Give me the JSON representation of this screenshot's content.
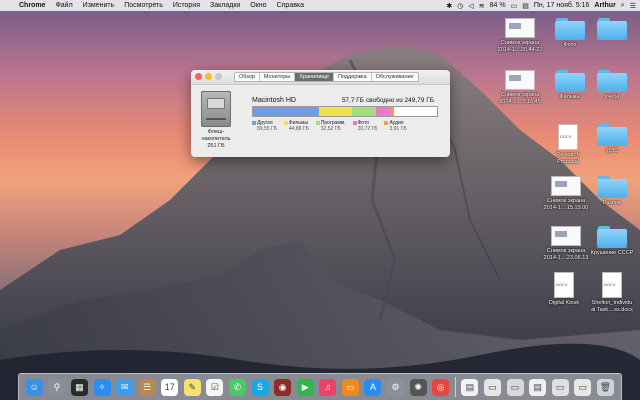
{
  "menubar": {
    "app": "Chrome",
    "items": [
      "Файл",
      "Изменить",
      "Посмотреть",
      "История",
      "Закладки",
      "Окно",
      "Справка"
    ],
    "battery": "84 %",
    "datetime": "Пн, 17 нояб.  5:16",
    "user": "Arthur"
  },
  "window": {
    "tabs": [
      "Обзор",
      "Мониторы",
      "Хранилище",
      "Поддержка",
      "Обслуживание"
    ],
    "active_tab": "Хранилище",
    "disk_label_lines": [
      "Флеш-",
      "накопитель",
      "251 ГБ"
    ],
    "disk_name": "Macintosh HD",
    "disk_free": "57,7 ГБ свободно из 249,79 ГБ",
    "storage": [
      {
        "label": "Другое",
        "size": "89,55 ГБ",
        "color": "#6f9fe0",
        "fraction": 0.358
      },
      {
        "label": "Фильмы",
        "size": "44,88 ГБ",
        "color": "#f5e04a",
        "fraction": 0.18
      },
      {
        "label": "Программ.",
        "size": "32,52 ГБ",
        "color": "#9ee07a",
        "fraction": 0.13
      },
      {
        "label": "Фото",
        "size": "20,72 ГБ",
        "color": "#f078c8",
        "fraction": 0.083
      },
      {
        "label": "Аудио",
        "size": "3,91 ГБ",
        "color": "#f5a03a",
        "fraction": 0.016
      }
    ]
  },
  "desktop_icons": [
    {
      "kind": "shot",
      "label": [
        "Снимок экрана",
        "2014-1....20.44.22"
      ]
    },
    {
      "kind": "folder",
      "label": [
        "Фото"
      ]
    },
    {
      "kind": "folder",
      "label": [
        ""
      ]
    },
    {
      "kind": "shot",
      "label": [
        "Снимок экрана",
        "2014-1....5.16.45"
      ]
    },
    {
      "kind": "folder",
      "label": [
        "Фильмы"
      ]
    },
    {
      "kind": "folder",
      "label": [
        "учеба"
      ]
    },
    {
      "kind": "doc",
      "label": [
        "Research",
        "Proposal"
      ]
    },
    {
      "kind": "folder",
      "label": [
        "@ЗС"
      ]
    },
    {
      "kind": "shot",
      "label": [
        "Снимок экрана",
        "2014-1....15.19.00"
      ]
    },
    {
      "kind": "folder",
      "label": [
        "Разное"
      ]
    },
    {
      "kind": "shot",
      "label": [
        "Снимок экрана",
        "2014-1....23.06.13"
      ]
    },
    {
      "kind": "folder",
      "label": [
        "Крушение СССР"
      ]
    },
    {
      "kind": "doc",
      "label": [
        "Digital Kiosk"
      ]
    },
    {
      "kind": "doc",
      "label": [
        "Shelton_Individu",
        "al Task....ss.docx"
      ]
    }
  ],
  "dock": [
    {
      "icon": "finder-icon",
      "color": "#3b8fe6",
      "glyph": "☺"
    },
    {
      "icon": "launchpad-icon",
      "color": "#8a8f99",
      "glyph": "⚲"
    },
    {
      "icon": "mission-control-icon",
      "color": "#2b2b2b",
      "glyph": "▦"
    },
    {
      "icon": "safari-icon",
      "color": "#2a8cf0",
      "glyph": "✧"
    },
    {
      "icon": "mail-icon",
      "color": "#3f9be8",
      "glyph": "✉"
    },
    {
      "icon": "contacts-icon",
      "color": "#b6874e",
      "glyph": "☰"
    },
    {
      "icon": "calendar-icon",
      "color": "#ffffff",
      "glyph": "17"
    },
    {
      "icon": "notes-icon",
      "color": "#f3e26b",
      "glyph": "✎"
    },
    {
      "icon": "reminders-icon",
      "color": "#f5f5f5",
      "glyph": "☑"
    },
    {
      "icon": "messages-icon",
      "color": "#4bc86a",
      "glyph": "✆"
    },
    {
      "icon": "skype-icon",
      "color": "#19a7e8",
      "glyph": "S"
    },
    {
      "icon": "photo-booth-icon",
      "color": "#8e2b2b",
      "glyph": "◉"
    },
    {
      "icon": "facetime-icon",
      "color": "#2fb84a",
      "glyph": "▶"
    },
    {
      "icon": "itunes-icon",
      "color": "#e8446a",
      "glyph": "♫"
    },
    {
      "icon": "ibooks-icon",
      "color": "#f08a1e",
      "glyph": "▭"
    },
    {
      "icon": "app-store-icon",
      "color": "#2a8cf0",
      "glyph": "A"
    },
    {
      "icon": "system-preferences-icon",
      "color": "#8a8f99",
      "glyph": "⚙"
    },
    {
      "icon": "aperture-icon",
      "color": "#555555",
      "glyph": "✺"
    },
    {
      "icon": "chrome-icon",
      "color": "#e9453f",
      "glyph": "◎"
    },
    {
      "icon": "separator",
      "color": "",
      "glyph": ""
    },
    {
      "icon": "document-stack-icon",
      "color": "#f2f2f2",
      "glyph": "▤"
    },
    {
      "icon": "screenshot-stack-icon",
      "color": "#e6e6e6",
      "glyph": "▭"
    },
    {
      "icon": "screenshot-stack-icon",
      "color": "#d9d9d9",
      "glyph": "▭"
    },
    {
      "icon": "downloads-stack-icon",
      "color": "#efefef",
      "glyph": "▤"
    },
    {
      "icon": "screenshot-stack-icon",
      "color": "#e0e0e0",
      "glyph": "▭"
    },
    {
      "icon": "screenshot-stack-icon",
      "color": "#e8e8e8",
      "glyph": "▭"
    },
    {
      "icon": "trash-icon",
      "color": "#cfd3d8",
      "glyph": "🗑"
    }
  ]
}
